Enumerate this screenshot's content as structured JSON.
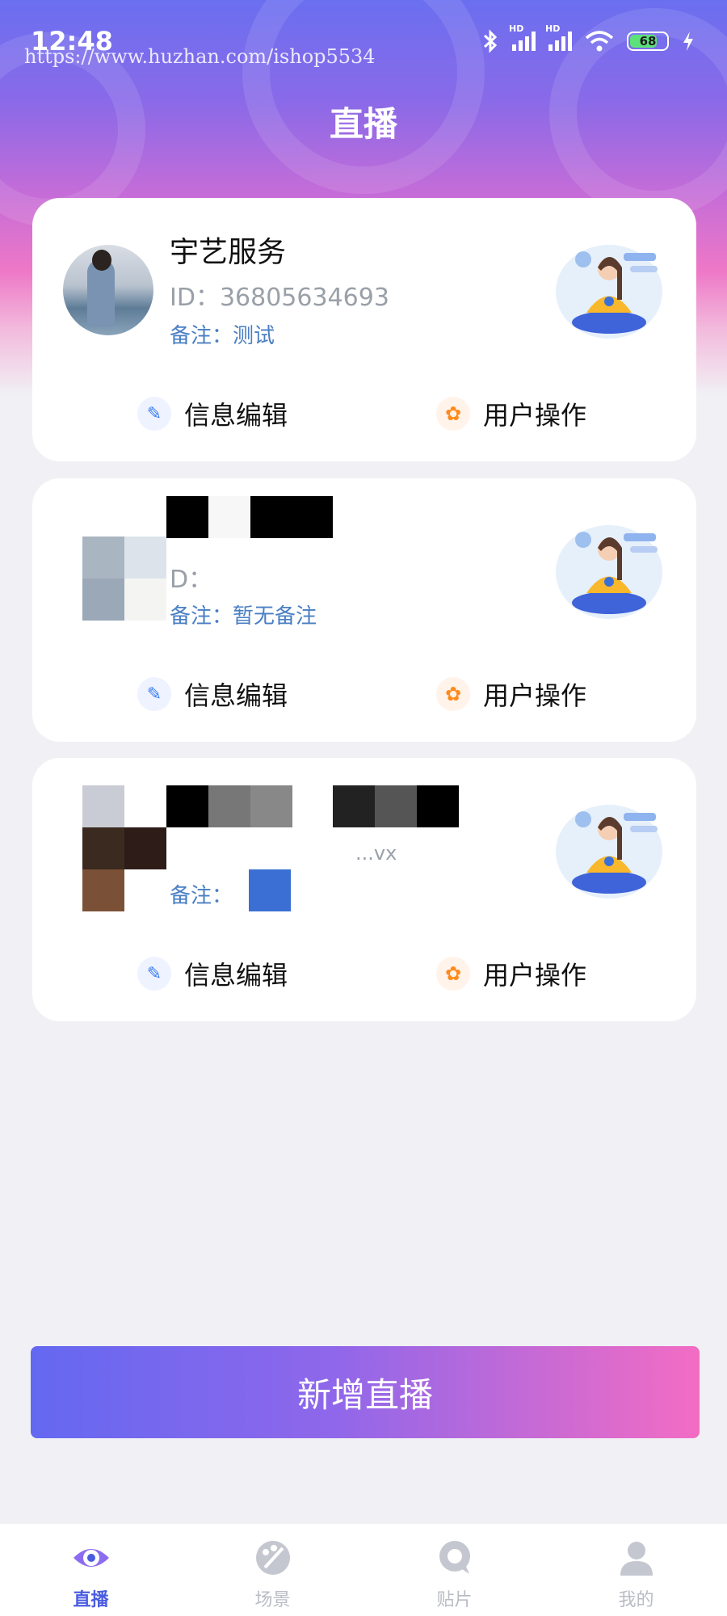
{
  "status_bar": {
    "time": "12:48",
    "watermark": "https://www.huzhan.com/ishop5534",
    "battery": "68"
  },
  "header": {
    "title": "直播"
  },
  "cards": [
    {
      "name": "宇艺服务",
      "id": "ID：36805634693",
      "note": "备注：测试",
      "edit_label": "信息编辑",
      "user_label": "用户操作"
    },
    {
      "name": "",
      "id": "D：",
      "note": "备注：暂无备注",
      "edit_label": "信息编辑",
      "user_label": "用户操作"
    },
    {
      "name": "",
      "id": "...vx",
      "note": "备注：",
      "edit_label": "信息编辑",
      "user_label": "用户操作"
    }
  ],
  "add_button": {
    "label": "新增直播"
  },
  "tabbar": {
    "items": [
      {
        "label": "直播",
        "icon": "eye-icon",
        "active": true
      },
      {
        "label": "场景",
        "icon": "palette-icon",
        "active": false
      },
      {
        "label": "贴片",
        "icon": "sticker-icon",
        "active": false
      },
      {
        "label": "我的",
        "icon": "user-icon",
        "active": false
      }
    ]
  },
  "colors": {
    "accent": "#4a5ce0",
    "note_text": "#4a7fc4",
    "edit_icon": "#3b7df2",
    "user_icon": "#ff8a1c",
    "button_gradient_start": "#6468f1",
    "button_gradient_end": "#f36cc4"
  }
}
